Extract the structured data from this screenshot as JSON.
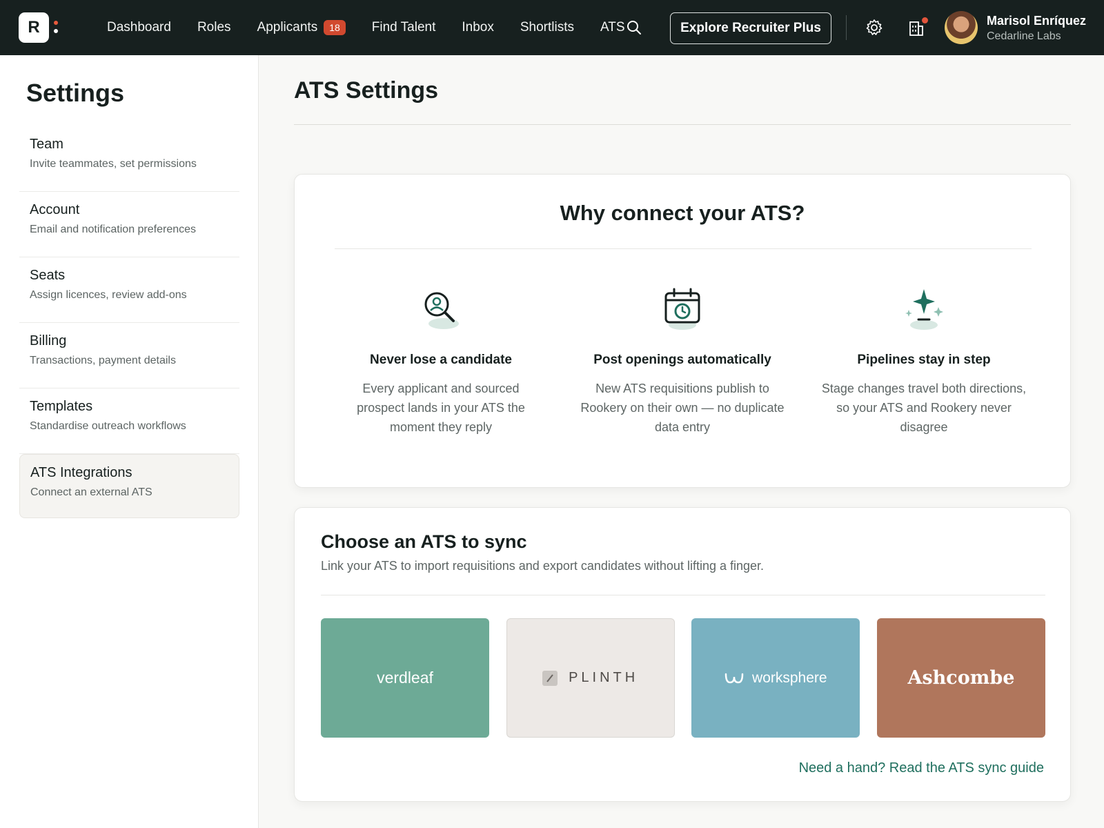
{
  "brand": {
    "logo_letter": "R"
  },
  "nav": {
    "links": [
      "Dashboard",
      "Roles",
      "Applicants",
      "Find Talent",
      "Inbox",
      "Shortlists",
      "ATS"
    ],
    "applicants_badge": "18",
    "explore_label": "Explore Recruiter Plus"
  },
  "user": {
    "name": "Marisol Enríquez",
    "org": "Cedarline Labs"
  },
  "sidebar": {
    "title": "Settings",
    "items": [
      {
        "title": "Team",
        "desc": "Invite teammates, set permissions"
      },
      {
        "title": "Account",
        "desc": "Email and notification preferences"
      },
      {
        "title": "Seats",
        "desc": "Assign licences, review add-ons"
      },
      {
        "title": "Billing",
        "desc": "Transactions, payment details"
      },
      {
        "title": "Templates",
        "desc": "Standardise outreach workflows"
      },
      {
        "title": "ATS Integrations",
        "desc": "Connect an external ATS",
        "active": true
      }
    ]
  },
  "main": {
    "title": "ATS Settings",
    "why": {
      "title": "Why connect your ATS?",
      "features": [
        {
          "icon": "candidate-search-icon",
          "title": "Never lose a candidate",
          "desc": "Every applicant and sourced prospect lands in your ATS the moment they reply"
        },
        {
          "icon": "calendar-clock-icon",
          "title": "Post openings automatically",
          "desc": "New ATS requisitions publish to Rookery on their own — no duplicate data entry"
        },
        {
          "icon": "sparkle-icon",
          "title": "Pipelines stay in step",
          "desc": "Stage changes travel both directions, so your ATS and Rookery never disagree"
        }
      ]
    },
    "choose": {
      "title": "Choose an ATS to sync",
      "subtitle": "Link your ATS to import requisitions and export candidates without lifting a finger.",
      "providers": [
        "verdleaf",
        "PLINTH",
        "worksphere",
        "Ashcombe"
      ],
      "guide_link": "Need a hand? Read the ATS sync guide"
    }
  },
  "colors": {
    "nav_bg": "#17201f",
    "accent": "#1f6f5e",
    "badge": "#d1492f"
  }
}
